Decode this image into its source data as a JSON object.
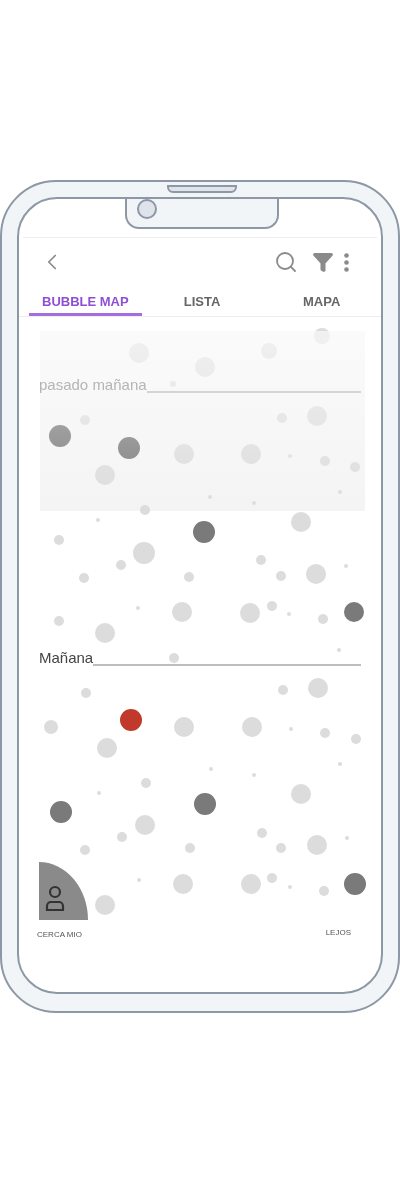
{
  "tabs": [
    {
      "label": "BUBBLE MAP",
      "selected": true
    },
    {
      "label": "LISTA",
      "selected": false
    },
    {
      "label": "MAPA",
      "selected": false
    }
  ],
  "bubble_map": {
    "sections": [
      {
        "label": "pasado mañana",
        "faded": true
      },
      {
        "label": "Mañana",
        "faded": false
      }
    ],
    "near_label": "CERCA MIO",
    "far_label": "LEJOS"
  }
}
